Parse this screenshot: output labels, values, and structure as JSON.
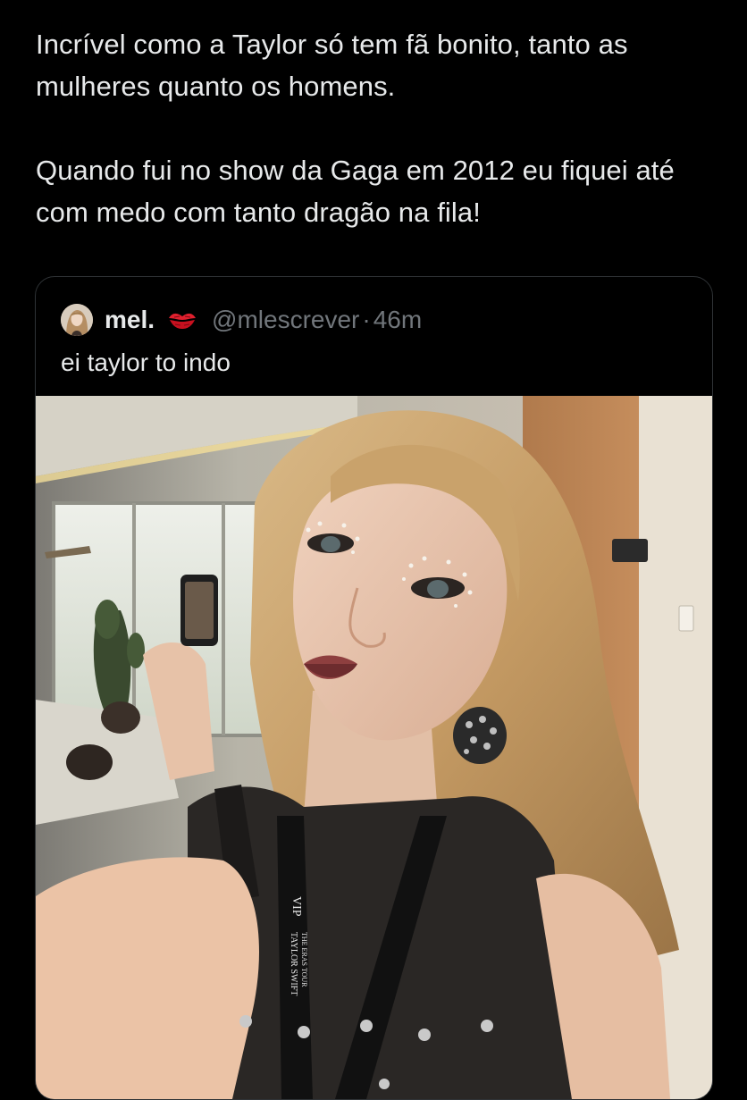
{
  "tweet": {
    "paragraph_1": "Incrível como a Taylor só tem fã bonito, tanto as mulheres quanto os homens.",
    "paragraph_2": "Quando fui no show da Gaga em 2012 eu fiquei até com medo com tanto dragão na fila!"
  },
  "quoted_tweet": {
    "display_name": "mel.",
    "name_emoji_icon": "kiss-mark-icon",
    "handle": "@mlescrever",
    "separator": "·",
    "timestamp": "46m",
    "text": "ei taylor to indo",
    "media": {
      "lanyard_text_1": "VIP",
      "lanyard_text_2": "TAYLOR SWIFT",
      "lanyard_text_3": "THE ERAS TOUR"
    }
  },
  "colors": {
    "background": "#000000",
    "text_primary": "#e7e9ea",
    "text_secondary": "#71767b",
    "card_border": "#2f3336"
  }
}
